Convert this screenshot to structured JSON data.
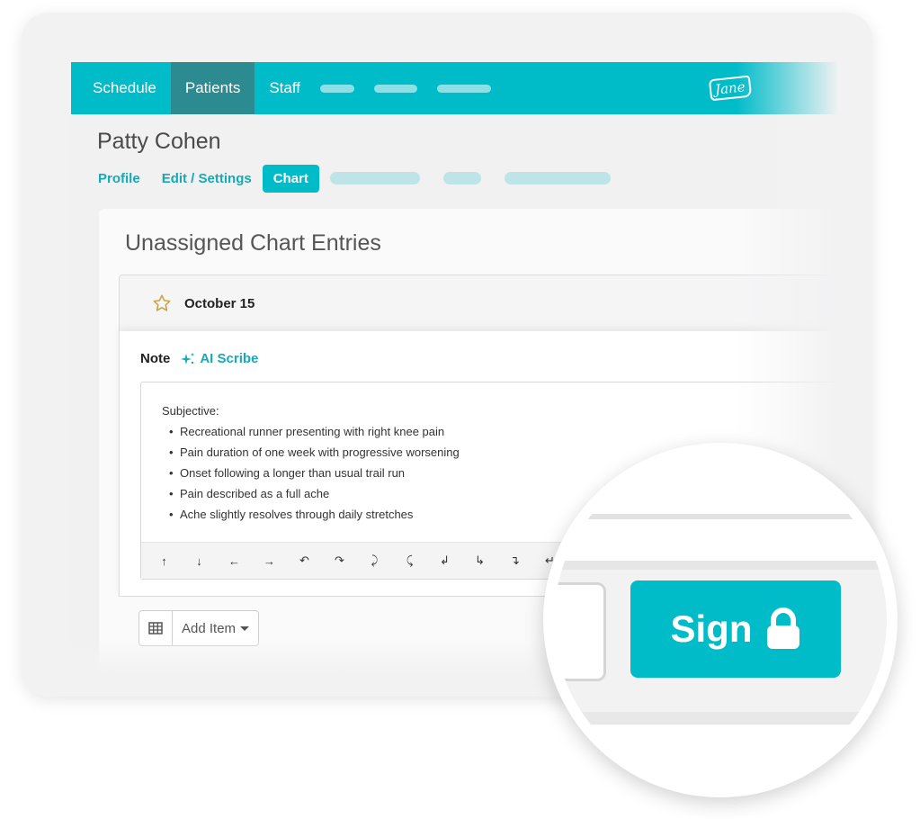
{
  "nav": {
    "items": [
      {
        "label": "Schedule",
        "active": false
      },
      {
        "label": "Patients",
        "active": true
      },
      {
        "label": "Staff",
        "active": false
      }
    ],
    "logo_text": "Jane"
  },
  "patient": {
    "name": "Patty Cohen"
  },
  "subnav": {
    "profile": "Profile",
    "edit_settings": "Edit / Settings",
    "chart": "Chart"
  },
  "chart": {
    "section_title": "Unassigned Chart Entries",
    "entry_date": "October 15",
    "note_label": "Note",
    "ai_scribe_label": "AI Scribe",
    "note": {
      "heading": "Subjective:",
      "bullets": [
        "Recreational runner presenting with right knee pain",
        "Pain duration of one week with progressive worsening",
        "Onset following a longer than usual trail run",
        "Pain described as a full ache",
        "Ache slightly resolves through daily stretches"
      ]
    },
    "symbols": [
      "↑",
      "↓",
      "←",
      "→",
      "↶",
      "↷",
      "⤸",
      "⤹",
      "↲",
      "↳",
      "↴",
      "↵"
    ],
    "add_item_label": "Add Item"
  },
  "sign_button": {
    "label": "Sign"
  },
  "colors": {
    "brand": "#00bcc9",
    "nav_active": "#2c8a91",
    "link": "#17a9b5",
    "star": "#c9a24a"
  },
  "icons": {
    "star": "star-icon",
    "ai_scribe": "sparkle-icon",
    "table": "table-icon",
    "lock": "lock-icon"
  }
}
